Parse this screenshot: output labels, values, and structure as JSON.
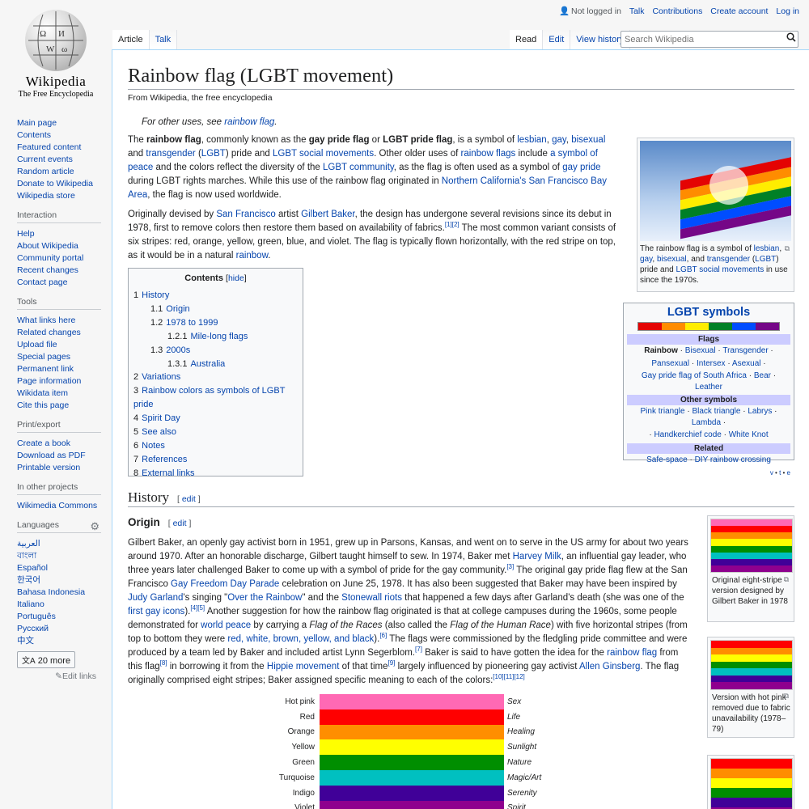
{
  "site": {
    "wordmark": "Wikipedia",
    "tagline": "The Free Encyclopedia"
  },
  "personal": {
    "not_logged": "Not logged in",
    "talk": "Talk",
    "contributions": "Contributions",
    "create": "Create account",
    "login": "Log in"
  },
  "tabs": {
    "article": "Article",
    "talk": "Talk",
    "read": "Read",
    "edit": "Edit",
    "history": "View history"
  },
  "search": {
    "placeholder": "Search Wikipedia"
  },
  "nav": {
    "items": [
      "Main page",
      "Contents",
      "Featured content",
      "Current events",
      "Random article",
      "Donate to Wikipedia",
      "Wikipedia store"
    ]
  },
  "interaction": {
    "heading": "Interaction",
    "items": [
      "Help",
      "About Wikipedia",
      "Community portal",
      "Recent changes",
      "Contact page"
    ]
  },
  "tools": {
    "heading": "Tools",
    "items": [
      "What links here",
      "Related changes",
      "Upload file",
      "Special pages",
      "Permanent link",
      "Page information",
      "Wikidata item",
      "Cite this page"
    ]
  },
  "print": {
    "heading": "Print/export",
    "items": [
      "Create a book",
      "Download as PDF",
      "Printable version"
    ]
  },
  "other": {
    "heading": "In other projects",
    "items": [
      "Wikimedia Commons"
    ]
  },
  "languages": {
    "heading": "Languages",
    "items": [
      "العربية",
      "বাংলা",
      "Español",
      "한국어",
      "Bahasa Indonesia",
      "Italiano",
      "Português",
      "Русский",
      "中文"
    ],
    "more": "20 more",
    "edit_links": "Edit links"
  },
  "article": {
    "title": "Rainbow flag (LGBT movement)",
    "site_sub": "From Wikipedia, the free encyclopedia",
    "hatnote_pre": "For other uses, see ",
    "hatnote_link": "rainbow flag",
    "hatnote_post": ".",
    "infobox_caption": {
      "a": "The rainbow flag is a symbol of ",
      "lesbian": "lesbian",
      ",": ", ",
      "gay": "gay",
      "bisexual": "bisexual",
      "and": ", and ",
      "transgender": "transgender",
      "lp": " (",
      "lgbt": "LGBT",
      "rp": ") pride and ",
      "social": "LGBT social movements",
      "end": " in use since the 1970s."
    },
    "toc": {
      "title": "Contents",
      "hide": "hide",
      "items": [
        {
          "n": "1",
          "t": "History",
          "lvl": 1
        },
        {
          "n": "1.1",
          "t": "Origin",
          "lvl": 2
        },
        {
          "n": "1.2",
          "t": "1978 to 1999",
          "lvl": 2
        },
        {
          "n": "1.2.1",
          "t": "Mile-long flags",
          "lvl": 3
        },
        {
          "n": "1.3",
          "t": "2000s",
          "lvl": 2
        },
        {
          "n": "1.3.1",
          "t": "Australia",
          "lvl": 3
        },
        {
          "n": "2",
          "t": "Variations",
          "lvl": 1
        },
        {
          "n": "3",
          "t": "Rainbow colors as symbols of LGBT pride",
          "lvl": 1
        },
        {
          "n": "4",
          "t": "Spirit Day",
          "lvl": 1
        },
        {
          "n": "5",
          "t": "See also",
          "lvl": 1
        },
        {
          "n": "6",
          "t": "Notes",
          "lvl": 1
        },
        {
          "n": "7",
          "t": "References",
          "lvl": 1
        },
        {
          "n": "8",
          "t": "External links",
          "lvl": 1
        }
      ]
    },
    "navbox": {
      "title": "LGBT symbols",
      "flags_h": "Flags",
      "flags_l1": [
        "Rainbow",
        "Bisexual",
        "Transgender"
      ],
      "flags_l2": [
        "Pansexual",
        "Intersex",
        "Asexual"
      ],
      "flags_l3": [
        "Gay pride flag of South Africa",
        "Bear",
        "Leather"
      ],
      "other_h": "Other symbols",
      "other_l1": [
        "Pink triangle",
        "Black triangle",
        "Labrys",
        "Lambda"
      ],
      "other_l2": [
        "Handkerchief code",
        "White Knot"
      ],
      "related_h": "Related",
      "related_l": [
        "Safe-space",
        "DIY rainbow crossing"
      ],
      "vte": [
        "v",
        "t",
        "e"
      ],
      "stripes": [
        "#e40303",
        "#ff8c00",
        "#ffed00",
        "#008026",
        "#004dff",
        "#750787"
      ]
    },
    "history": "History",
    "origin": "Origin",
    "edit": "edit",
    "thumb1": "Original eight-stripe version designed by Gilbert Baker in 1978",
    "thumb2": "Version with hot pink removed due to fabric unavailability (1978–79)",
    "colors": [
      {
        "name": "Hot pink",
        "hex": "#ff69b4",
        "meaning": "Sex"
      },
      {
        "name": "Red",
        "hex": "#ff0000",
        "meaning": "Life"
      },
      {
        "name": "Orange",
        "hex": "#ff8e00",
        "meaning": "Healing"
      },
      {
        "name": "Yellow",
        "hex": "#ffff00",
        "meaning": "Sunlight"
      },
      {
        "name": "Green",
        "hex": "#008e00",
        "meaning": "Nature"
      },
      {
        "name": "Turquoise",
        "hex": "#00c0c0",
        "meaning": "Magic/Art"
      },
      {
        "name": "Indigo",
        "hex": "#400098",
        "meaning": "Serenity"
      },
      {
        "name": "Violet",
        "hex": "#8e008e",
        "meaning": "Spirit"
      }
    ]
  }
}
